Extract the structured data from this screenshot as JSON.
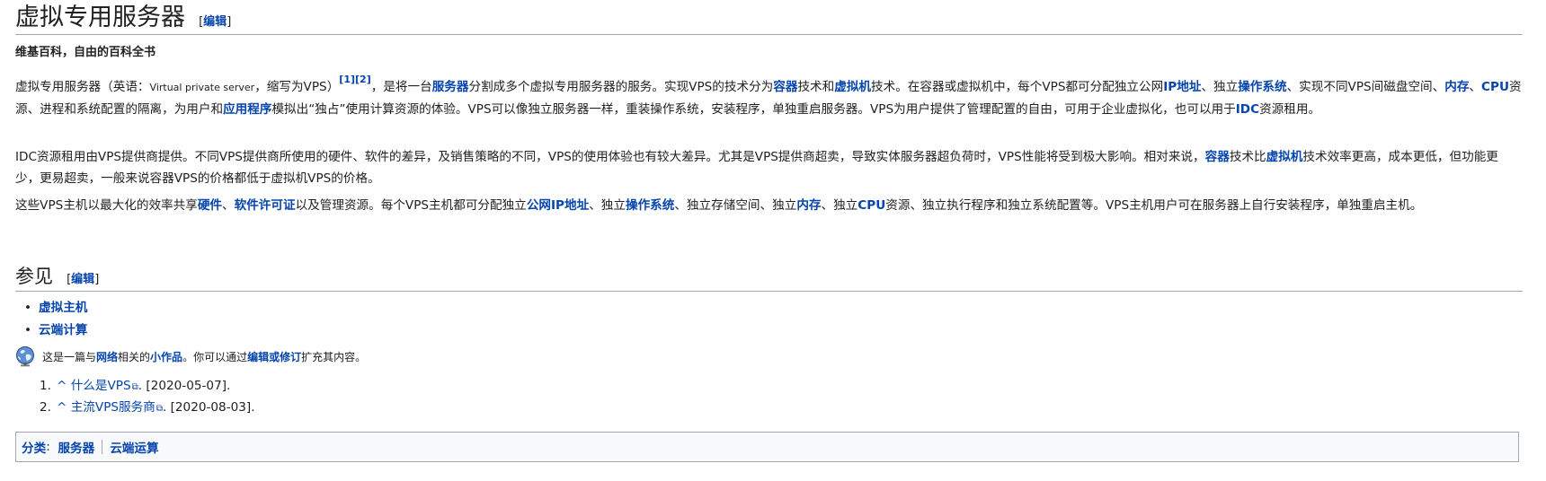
{
  "article": {
    "title": "虚拟专用服务器",
    "edit_label": "编辑",
    "tagline": "维基百科，自由的百科全书"
  },
  "para1": {
    "t1": "虚拟专用服务器（英语：",
    "english": "Virtual private server",
    "t2": "，缩写为VPS）",
    "ref1": "[1]",
    "ref2": "[2]",
    "t3": "，是将一台",
    "l_server": "服务器",
    "t4": "分割成多个虚拟专用服务器的服务。实现VPS的技术分为",
    "l_container": "容器",
    "t5": "技术和",
    "l_vm": "虚拟机",
    "t6": "技术。在容器或虚拟机中，每个VPS都可分配独立公网",
    "l_ip": "IP地址",
    "t7": "、独立",
    "l_os": "操作系统",
    "t8": "、实现不同VPS间磁盘空间、",
    "l_mem": "内存",
    "t9": "、",
    "l_cpu": "CPU",
    "t10": "资源、进程和系统配置的隔离，为用户和",
    "l_app": "应用程序",
    "t11": "模拟出“独占”使用计算资源的体验。VPS可以像独立服务器一样，重装操作系统，安装程序，单独重启服务器。VPS为用户提供了管理配置的自由，可用于企业虚拟化，也可以用于",
    "l_idc": "IDC",
    "t12": "资源租用。"
  },
  "para2": {
    "t1": "IDC资源租用由VPS提供商提供。不同VPS提供商所使用的硬件、软件的差异，及销售策略的不同，VPS的使用体验也有较大差异。尤其是VPS提供商超卖，导致实体服务器超负荷时，VPS性能将受到极大影响。相对来说，",
    "l_container": "容器",
    "t2": "技术比",
    "l_vm": "虚拟机",
    "t3": "技术效率更高，成本更低，但功能更少，更易超卖，一般来说容器VPS的价格都低于虚拟机VPS的价格。"
  },
  "para3": {
    "t1": "这些VPS主机以最大化的效率共享",
    "l_hw": "硬件",
    "t2": "、",
    "l_license": "软件许可证",
    "t3": "以及管理资源。每个VPS主机都可分配独立",
    "l_pubip": "公网IP地址",
    "t4": "、独立",
    "l_os": "操作系统",
    "t5": "、独立存储空间、独立",
    "l_mem": "内存",
    "t6": "、独立",
    "l_cpu": "CPU",
    "t7": "资源、独立执行程序和独立系统配置等。VPS主机用户可在服务器上自行安装程序，单独重启主机。"
  },
  "see_also": {
    "heading": "参见",
    "edit_label": "编辑",
    "items": [
      "虚拟主机",
      "云端计算"
    ]
  },
  "stub": {
    "t1": "这是一篇与",
    "l_network": "网络",
    "t2": "相关的",
    "l_stub": "小作品",
    "t3": "。你可以通过",
    "l_edit": "编辑或修订",
    "t4": "扩充其内容。",
    "icon": "globe-icon"
  },
  "references": [
    {
      "num": "1.",
      "caret": "^",
      "title": "什么是VPS",
      "date": ". [2020-05-07]."
    },
    {
      "num": "2.",
      "caret": "^",
      "title": "主流VPS服务商",
      "date": ". [2020-08-03]."
    }
  ],
  "categories": {
    "label": "分类",
    "colon": ":",
    "items": [
      "服务器",
      "云端运算"
    ]
  },
  "colors": {
    "link": "#0645ad",
    "text": "#202122",
    "rule": "#a2a9b1",
    "cat_bg": "#f8f9fa"
  }
}
